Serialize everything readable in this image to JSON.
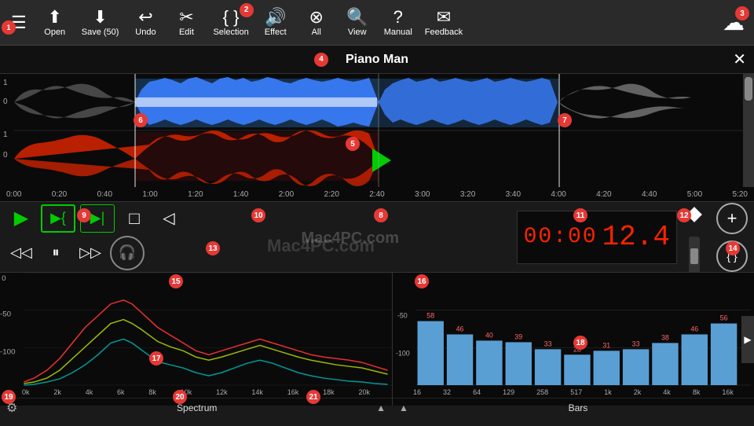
{
  "toolbar": {
    "hamburger_label": "☰",
    "open_label": "Open",
    "save_label": "Save (50)",
    "undo_label": "Undo",
    "edit_label": "Edit",
    "selection_label": "Selection",
    "effect_label": "Effect",
    "all_label": "All",
    "view_label": "View",
    "manual_label": "Manual",
    "feedback_label": "Feedback",
    "cloud_label": "☁",
    "badge_2": "2",
    "badge_3": "3"
  },
  "title_bar": {
    "title": "Piano Man",
    "close": "✕",
    "badge_4": "4"
  },
  "timeline": {
    "labels": [
      "0:00",
      "0:20",
      "0:40",
      "1:00",
      "1:20",
      "1:40",
      "2:00",
      "2:20",
      "2:40",
      "3:00",
      "3:20",
      "3:40",
      "4:00",
      "4:20",
      "4:40",
      "5:00",
      "5:20"
    ]
  },
  "transport": {
    "play": "▷",
    "play_sel": "▷{",
    "skip_fwd": "▷|",
    "stop": "□",
    "volume": "◁",
    "rewind": "◁◁",
    "pause": "⏸",
    "fast_fwd": "▷▷",
    "headphone": "◉",
    "time": "00:00",
    "level": "12.4",
    "badge_8": "8",
    "badge_9": "9",
    "badge_10": "10",
    "badge_11": "11",
    "badge_12": "12",
    "badge_13": "13",
    "badge_14": "14"
  },
  "watermark": "Mac4PC.com",
  "spectrum": {
    "label": "Spectrum",
    "y_labels": [
      "0",
      "-50",
      "-100"
    ],
    "x_labels": [
      "0k",
      "2k",
      "4k",
      "6k",
      "8k",
      "10k",
      "12k",
      "14k",
      "16k",
      "18k",
      "20k"
    ],
    "badge_15": "15",
    "badge_17": "17",
    "badge_19": "19",
    "badge_20": "20",
    "badge_21": "21"
  },
  "bars": {
    "label": "Bars",
    "badge_16": "16",
    "badge_18": "18",
    "y_labels": [
      "-50",
      "-100"
    ],
    "x_labels": [
      "16",
      "32",
      "64",
      "129",
      "258",
      "517",
      "1k",
      "2k",
      "4k",
      "8k",
      "16k"
    ],
    "bar_values": [
      58,
      46,
      40,
      39,
      33,
      28,
      31,
      33,
      38,
      46,
      56
    ],
    "bar_labels_top": [
      "58",
      "46",
      "40",
      "39",
      "33",
      "28",
      "31",
      "33",
      "38",
      "46",
      "56"
    ]
  }
}
